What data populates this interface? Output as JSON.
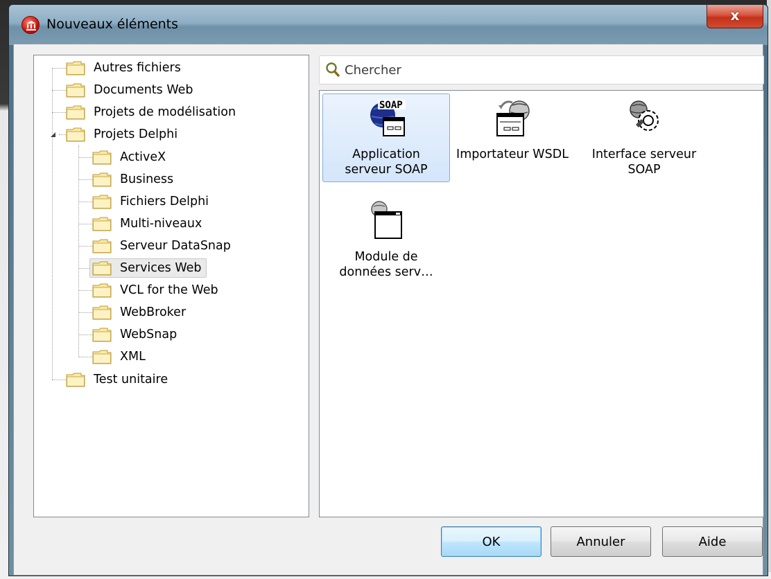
{
  "window": {
    "title": "Nouveaux éléments",
    "close_label": "x"
  },
  "search": {
    "placeholder": "Chercher",
    "value": ""
  },
  "tree": {
    "items": [
      {
        "label": "Autres fichiers",
        "level": 0
      },
      {
        "label": "Documents Web",
        "level": 0
      },
      {
        "label": "Projets de modélisation",
        "level": 0
      },
      {
        "label": "Projets Delphi",
        "level": 0,
        "expanded": true
      },
      {
        "label": "ActiveX",
        "level": 1
      },
      {
        "label": "Business",
        "level": 1
      },
      {
        "label": "Fichiers Delphi",
        "level": 1
      },
      {
        "label": "Multi-niveaux",
        "level": 1
      },
      {
        "label": "Serveur DataSnap",
        "level": 1
      },
      {
        "label": "Services Web",
        "level": 1,
        "selected": true
      },
      {
        "label": "VCL for the Web",
        "level": 1
      },
      {
        "label": "WebBroker",
        "level": 1
      },
      {
        "label": "WebSnap",
        "level": 1
      },
      {
        "label": "XML",
        "level": 1
      },
      {
        "label": "Test unitaire",
        "level": 0
      }
    ]
  },
  "gallery": {
    "items": [
      {
        "label_line1": "Application",
        "label_line2": "serveur SOAP",
        "icon": "soap-server-icon",
        "selected": true
      },
      {
        "label_line1": "Importateur WSDL",
        "label_line2": "",
        "icon": "wsdl-importer-icon"
      },
      {
        "label_line1": "Interface serveur",
        "label_line2": "SOAP",
        "icon": "soap-interface-icon"
      },
      {
        "label_line1": "Module de",
        "label_line2": "données serv…",
        "icon": "server-data-module-icon"
      }
    ]
  },
  "buttons": {
    "ok": "OK",
    "cancel": "Annuler",
    "help": "Aide"
  },
  "colors": {
    "selection_bg": "#d4e6fb",
    "selection_border": "#84acdd",
    "folder_fill": "#fbeaa2",
    "folder_stroke": "#b89a3a"
  }
}
